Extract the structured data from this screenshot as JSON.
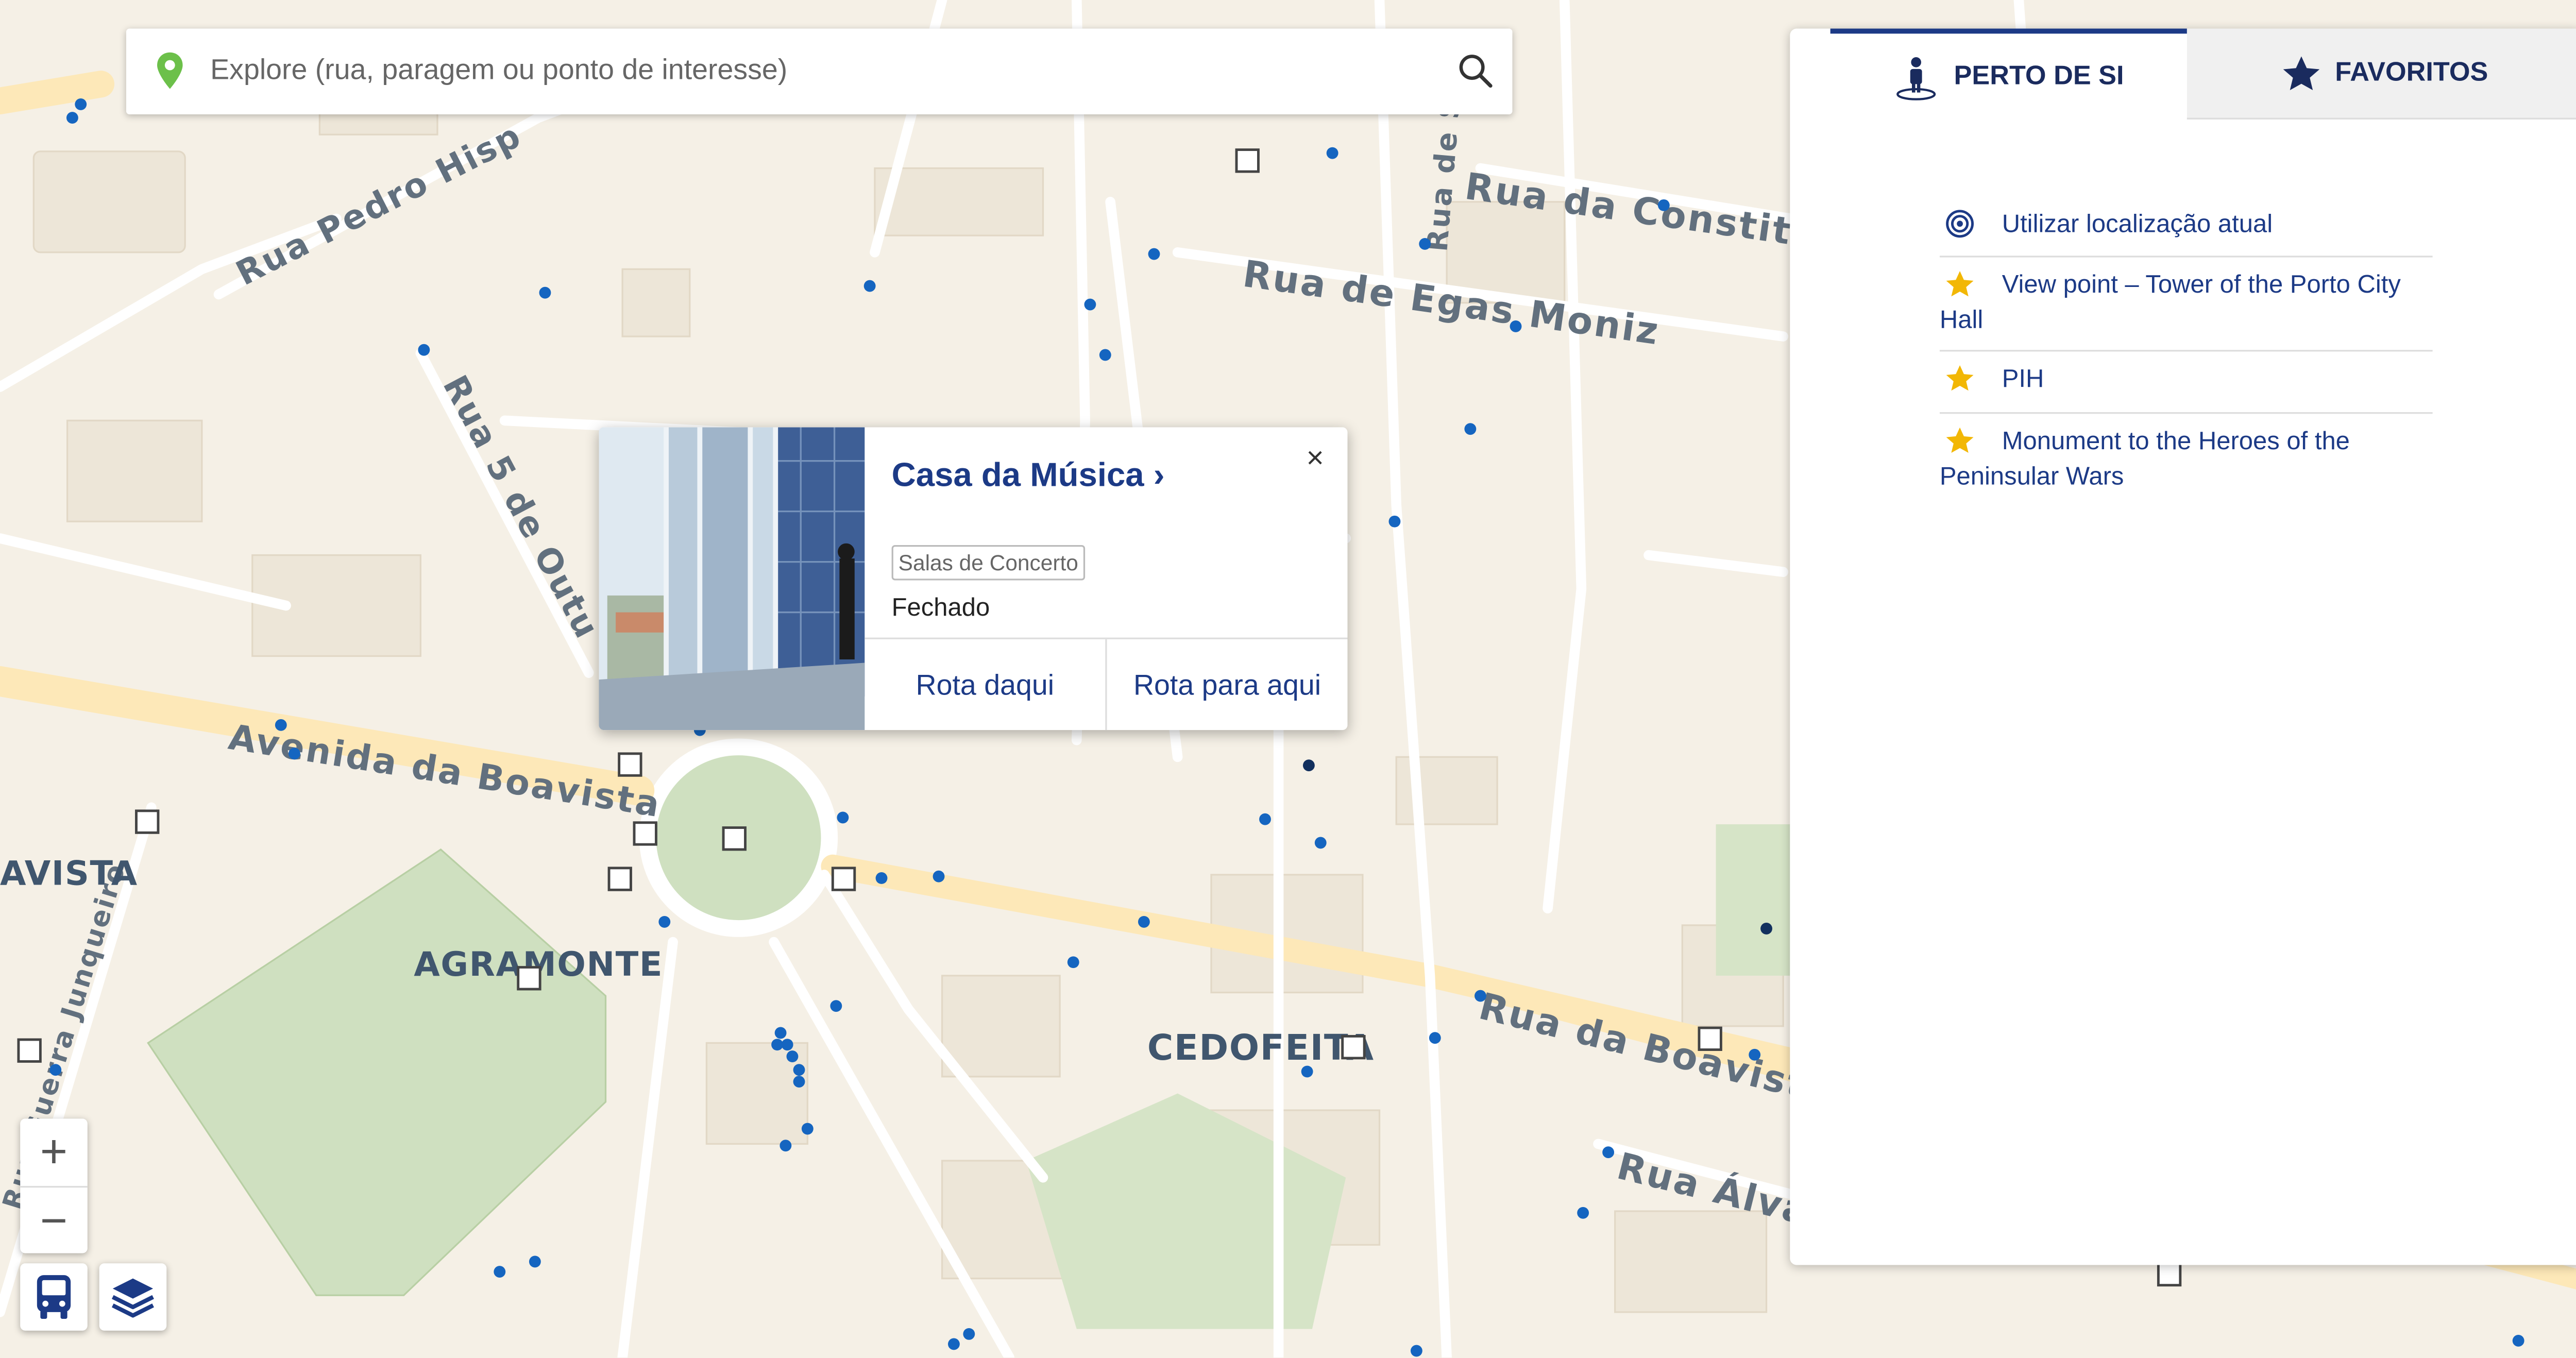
{
  "search": {
    "placeholder": "Explore (rua, paragem ou ponto de interesse)"
  },
  "map": {
    "streets": [
      "Rua Pedro Hisp",
      "Rua da Constitu",
      "Rua de Egas Moniz",
      "Rua 5 de Outu",
      "Avenida da Boavista",
      "Rua da Boavist",
      "Rua Álva",
      "Rua Guerra Junqueiro",
      "Rua de S"
    ],
    "areas": [
      "AVISTA",
      "AGRAMONTE",
      "CEDOFEITA"
    ],
    "zoom_in": "+",
    "zoom_out": "−"
  },
  "popup": {
    "title": "Casa da Música ›",
    "category": "Salas de Concerto",
    "status": "Fechado",
    "close": "×",
    "route_from": "Rota daqui",
    "route_to": "Rota para aqui"
  },
  "panel": {
    "tabs": [
      {
        "label": "PERTO DE SI",
        "icon": "person-pin-icon"
      },
      {
        "label": "FAVORITOS",
        "icon": "star-icon"
      }
    ],
    "items": [
      {
        "label": "Utilizar localização atual",
        "icon": "target-icon"
      },
      {
        "label": "View point – Tower of the Porto City Hall",
        "icon": "star-icon"
      },
      {
        "label": "PIH",
        "icon": "star-icon"
      },
      {
        "label": "Monument to the Heroes of the Peninsular Wars",
        "icon": "star-icon"
      }
    ]
  },
  "colors": {
    "accent": "#1c3a86",
    "star": "#f2b705",
    "stop_dot": "#1565c0",
    "pin": "#6cc04a"
  }
}
